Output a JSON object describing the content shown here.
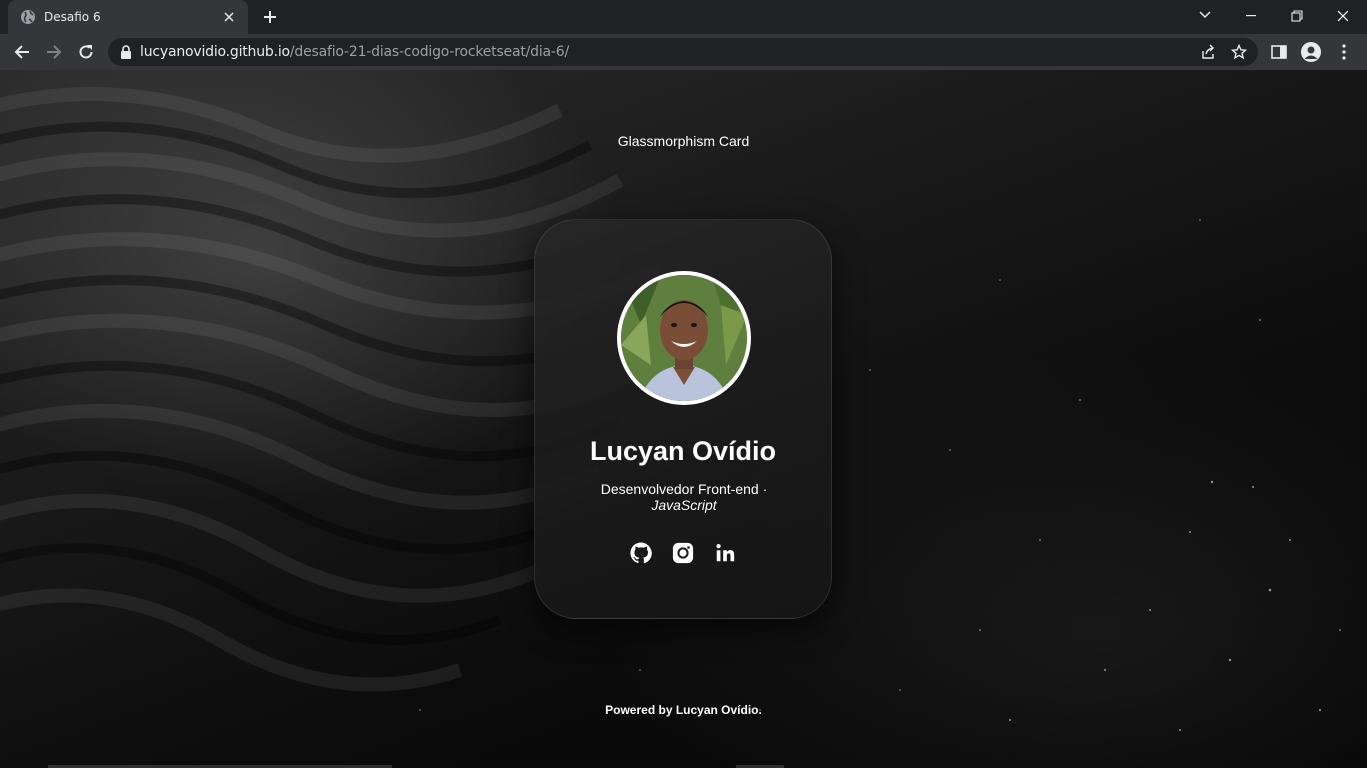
{
  "browser": {
    "tab_title": "Desafio 6",
    "url_host": "lucyanovidio.github.io",
    "url_path": "/desafio-21-dias-codigo-rocketseat/dia-6/"
  },
  "page": {
    "heading": "Glassmorphism Card",
    "footer_prefix": "Powered by ",
    "footer_author": "Lucyan Ovídio",
    "footer_suffix": "."
  },
  "card": {
    "name": "Lucyan Ovídio",
    "role": "Desenvolvedor Front-end · ",
    "role_lang": "JavaScript",
    "socials": [
      "github-icon",
      "instagram-icon",
      "linkedin-icon"
    ]
  },
  "colors": {
    "chrome_dark": "#202124",
    "chrome_toolbar": "#35363a",
    "text_primary": "#ffffff",
    "url_muted": "#9aa0a6"
  }
}
